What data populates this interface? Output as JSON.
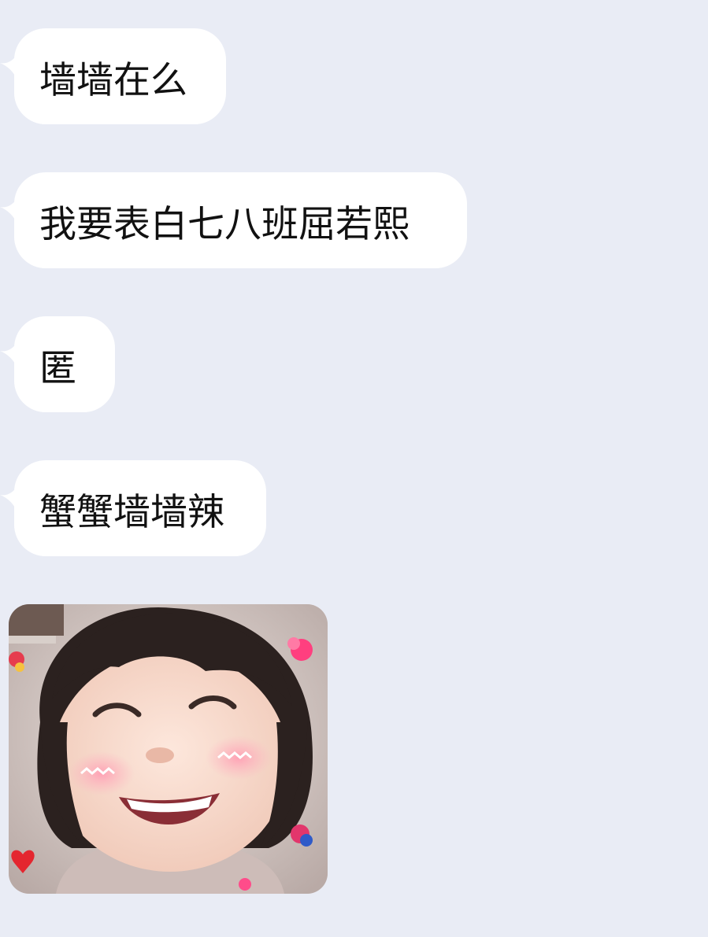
{
  "messages": [
    {
      "text": "墙墙在么"
    },
    {
      "text": "我要表白七八班屈若熙"
    },
    {
      "text": "匿"
    },
    {
      "text": "蟹蟹墙墙辣"
    }
  ],
  "sticker": {
    "icon": "smiling-child-sticker-icon"
  },
  "colors": {
    "background": "#e9ecf5",
    "bubble": "#ffffff",
    "text": "#111111"
  }
}
